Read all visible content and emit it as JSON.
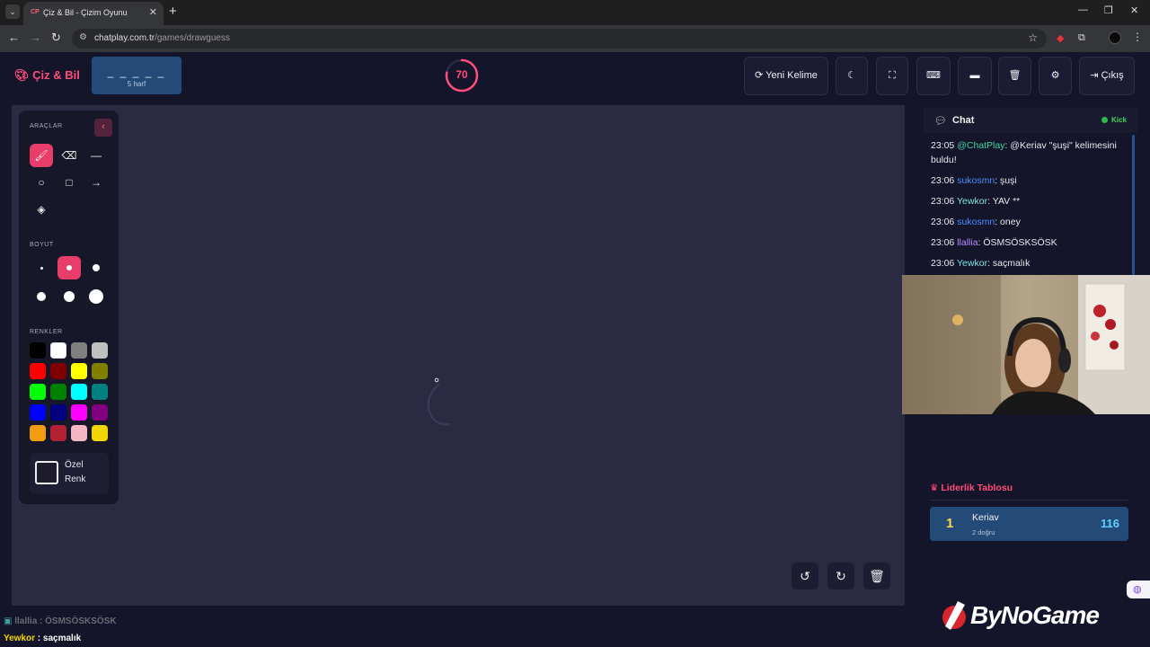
{
  "browser": {
    "tab_title": "Çiz & Bil - Çizim Oyunu",
    "tab_favicon": "CP",
    "url_domain": "chatplay.com.tr",
    "url_path": "/games/drawguess"
  },
  "header": {
    "logo": "Çiz & Bil",
    "word_mask": "_ _ _ _ _",
    "word_length": "5 harf",
    "timer": "70",
    "timer_fraction": 0.78,
    "new_word_label": "Yeni Kelime",
    "exit_label": "Çıkış",
    "accent_color": "#ff4d7a"
  },
  "tools": {
    "section_tools": "ARAÇLAR",
    "section_size": "BOYUT",
    "section_colors": "RENKLER",
    "custom_color_label": "Özel Renk",
    "items": [
      {
        "icon": "brush-icon",
        "active": true
      },
      {
        "icon": "eraser-icon",
        "active": false
      },
      {
        "icon": "line-icon",
        "active": false
      },
      {
        "icon": "circle-icon",
        "active": false
      },
      {
        "icon": "rectangle-icon",
        "active": false
      },
      {
        "icon": "arrow-icon",
        "active": false
      },
      {
        "icon": "fill-bucket-icon",
        "active": false
      }
    ],
    "selected_size_index": 1,
    "colors": [
      "#000000",
      "#ffffff",
      "#808080",
      "#c0c0c0",
      "#ff0000",
      "#800000",
      "#ffff00",
      "#808000",
      "#00ff00",
      "#008000",
      "#00ffff",
      "#008080",
      "#0000ff",
      "#000080",
      "#ff00ff",
      "#800080",
      "#f39c12",
      "#b22234",
      "#f4b6c2",
      "#f1d600"
    ],
    "selected_color_index": 1
  },
  "chat": {
    "title": "Chat",
    "platform": "Kick",
    "messages": [
      {
        "time": "23:05",
        "user": "@ChatPlay",
        "user_color": "#3fd4a0",
        "text": ": @Keriav \"şuşi\" kelimesini buldu!"
      },
      {
        "time": "23:06",
        "user": "sukosmn",
        "user_color": "#4a8cff",
        "text": ": şuşi"
      },
      {
        "time": "23:06",
        "user": "Yewkor",
        "user_color": "#7fe0e0",
        "text": ": YAV **"
      },
      {
        "time": "23:06",
        "user": "sukosmn",
        "user_color": "#4a8cff",
        "text": ": oney"
      },
      {
        "time": "23:06",
        "user": "llallia",
        "user_color": "#b48cff",
        "text": ": ÖSMSÖSKSÖSK"
      },
      {
        "time": "23:06",
        "user": "Yewkor",
        "user_color": "#7fe0e0",
        "text": ": saçmalık"
      }
    ]
  },
  "leaderboard": {
    "title": "Liderlik Tablosu",
    "rows": [
      {
        "rank": "1",
        "name": "Keriav",
        "sub": "2 doğru",
        "score": "116"
      }
    ]
  },
  "overlay": {
    "brand": "ByNoGame",
    "chat_line1_user": "llallia",
    "chat_line1_text": " : ÖSMSÖSKSÖSK",
    "chat_line2_user": "Yewkor",
    "chat_line2_text": " : saçmalık"
  }
}
